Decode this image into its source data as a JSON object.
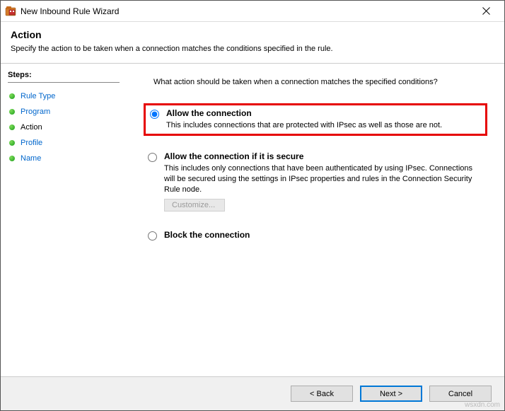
{
  "window": {
    "title": "New Inbound Rule Wizard"
  },
  "header": {
    "title": "Action",
    "subtitle": "Specify the action to be taken when a connection matches the conditions specified in the rule."
  },
  "sidebar": {
    "title": "Steps:",
    "items": [
      {
        "label": "Rule Type",
        "current": false
      },
      {
        "label": "Program",
        "current": false
      },
      {
        "label": "Action",
        "current": true
      },
      {
        "label": "Profile",
        "current": false
      },
      {
        "label": "Name",
        "current": false
      }
    ]
  },
  "main": {
    "prompt": "What action should be taken when a connection matches the specified conditions?",
    "options": [
      {
        "id": "allow",
        "label": "Allow the connection",
        "desc": "This includes connections that are protected with IPsec as well as those are not.",
        "checked": true,
        "highlighted": true
      },
      {
        "id": "allow-secure",
        "label": "Allow the connection if it is secure",
        "desc": "This includes only connections that have been authenticated by using IPsec. Connections will be secured using the settings in IPsec properties and rules in the Connection Security Rule node.",
        "checked": false,
        "customize": "Customize..."
      },
      {
        "id": "block",
        "label": "Block the connection",
        "checked": false
      }
    ]
  },
  "footer": {
    "back": "< Back",
    "next": "Next >",
    "cancel": "Cancel"
  },
  "watermark": "wsxdn.com"
}
